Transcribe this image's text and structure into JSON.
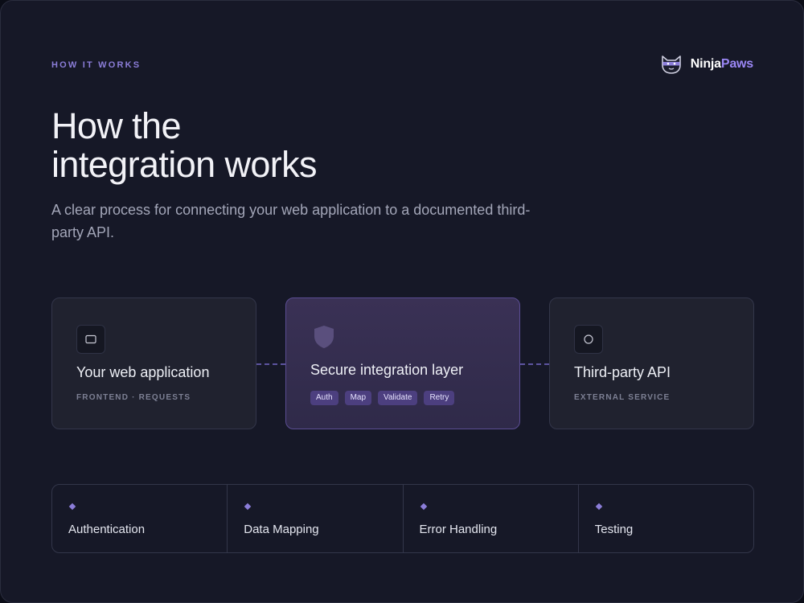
{
  "eyebrow": "HOW IT WORKS",
  "brand": {
    "name_part1": "Ninja",
    "name_part2": "Paws",
    "logo_icon": "ninja-cat-icon"
  },
  "hero": {
    "title_line1": "How the",
    "title_line2": "integration works",
    "subtitle": "A clear process for connecting your web application to a documented third-party API."
  },
  "cards": {
    "left": {
      "icon": "monitor-icon",
      "title": "Your web application",
      "meta": "FRONTEND · REQUESTS"
    },
    "center": {
      "icon": "shield-icon",
      "title": "Secure integration layer",
      "pills": [
        "Auth",
        "Map",
        "Validate",
        "Retry"
      ]
    },
    "right": {
      "icon": "circle-icon",
      "title": "Third-party API",
      "meta": "EXTERNAL SERVICE"
    }
  },
  "features": [
    "Authentication",
    "Data Mapping",
    "Error Handling",
    "Testing"
  ],
  "colors": {
    "background": "#161827",
    "accent": "#8b7dd8",
    "brand_accent": "#9b87f5",
    "card": "#20222f",
    "card_highlight": "#3a3155",
    "pill": "#4c3f7f"
  }
}
